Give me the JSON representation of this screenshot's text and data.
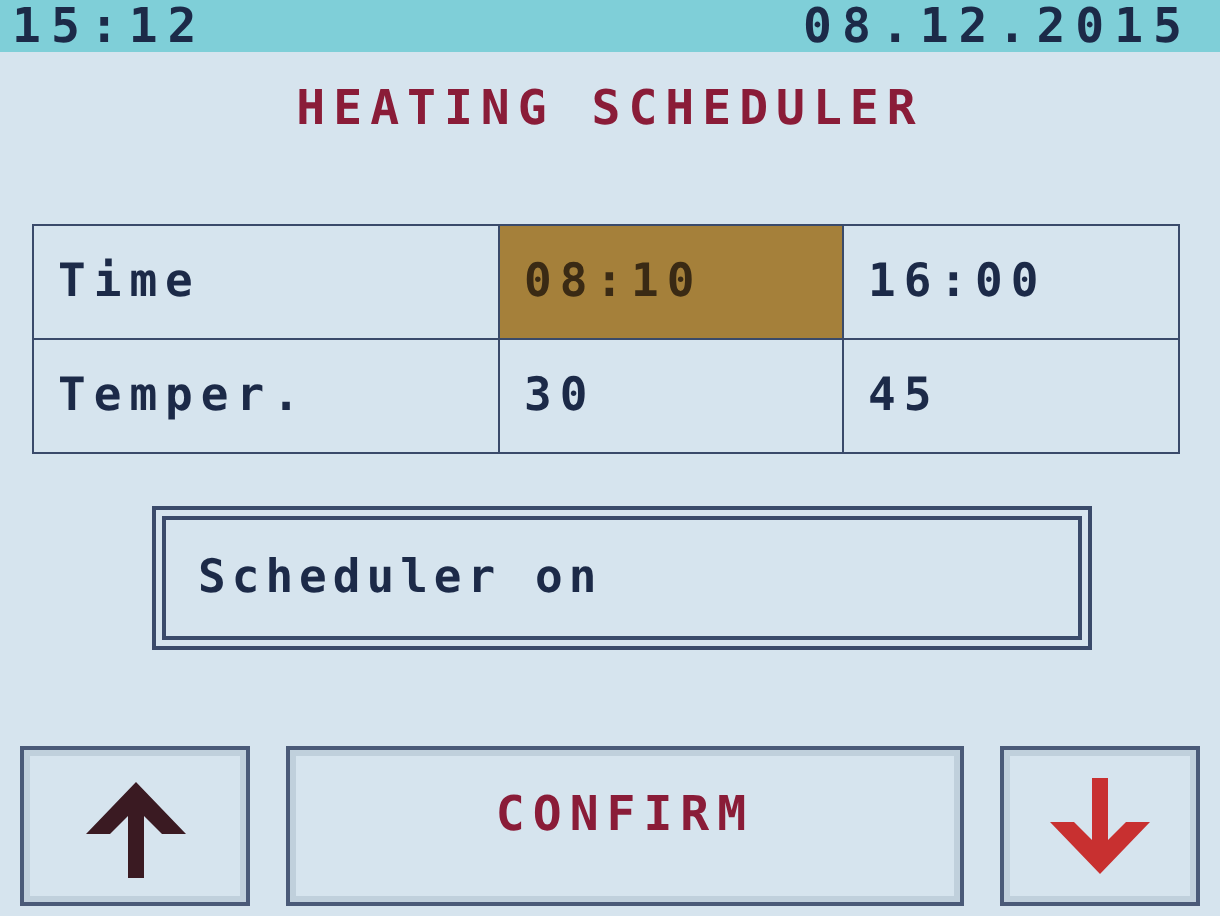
{
  "status_bar": {
    "time": "15:12",
    "date": "08.12.2015"
  },
  "title": "HEATING SCHEDULER",
  "table": {
    "rows": [
      {
        "label": "Time",
        "cells": [
          {
            "text": "08:10",
            "selected": true
          },
          {
            "text": "16:00",
            "selected": false
          }
        ]
      },
      {
        "label": "Temper.",
        "cells": [
          {
            "text": "30",
            "selected": false
          },
          {
            "text": "45",
            "selected": false
          }
        ]
      }
    ]
  },
  "scheduler_toggle": {
    "label": "Scheduler on"
  },
  "buttons": [
    {
      "kind": "up"
    },
    {
      "kind": "confirm",
      "label": "CONFIRM"
    },
    {
      "kind": "down"
    }
  ]
}
